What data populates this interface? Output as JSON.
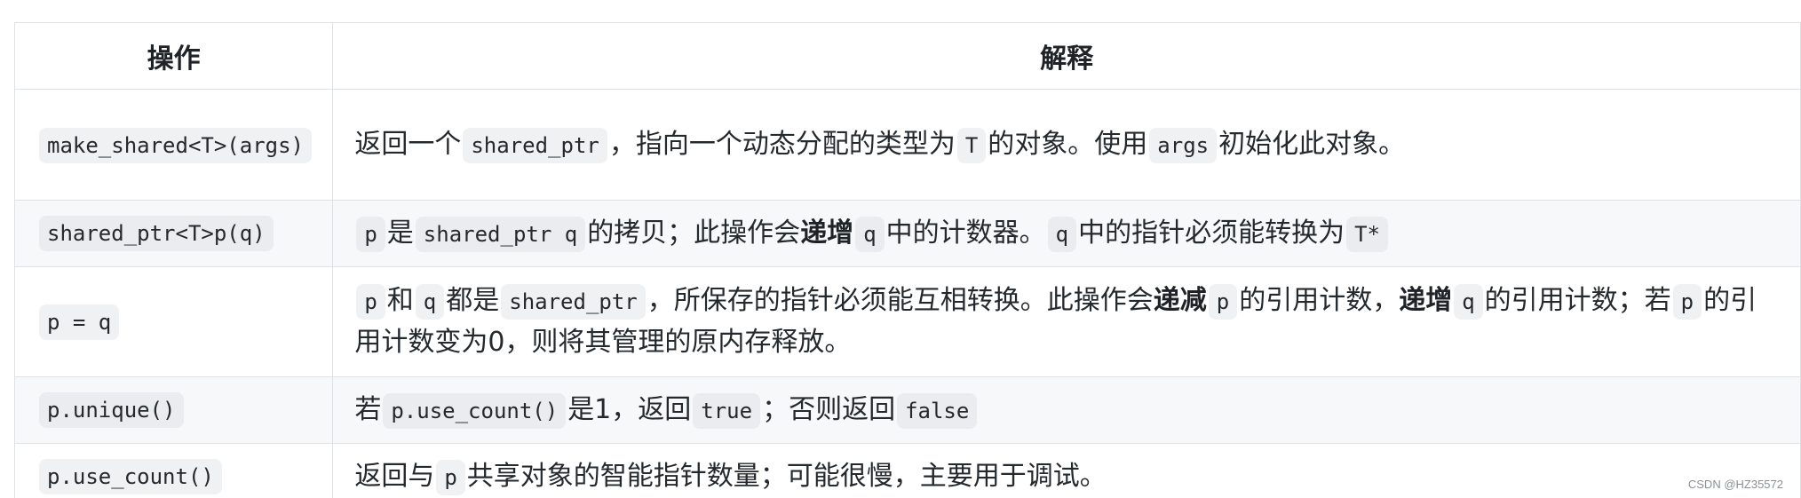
{
  "table": {
    "headers": [
      "操作",
      "解释"
    ],
    "rows": [
      {
        "op": "make_shared<T>(args)",
        "desc": [
          {
            "t": "text",
            "v": "返回一个"
          },
          {
            "t": "code",
            "v": "shared_ptr"
          },
          {
            "t": "text",
            "v": "，指向一个动态分配的类型为"
          },
          {
            "t": "code",
            "v": "T"
          },
          {
            "t": "text",
            "v": "的对象。使用"
          },
          {
            "t": "code",
            "v": "args"
          },
          {
            "t": "text",
            "v": "初始化此对象。"
          }
        ]
      },
      {
        "op": "shared_ptr<T>p(q)",
        "desc": [
          {
            "t": "code",
            "v": "p"
          },
          {
            "t": "text",
            "v": "是"
          },
          {
            "t": "code",
            "v": "shared_ptr q"
          },
          {
            "t": "text",
            "v": "的拷贝；此操作会"
          },
          {
            "t": "bold",
            "v": "递增"
          },
          {
            "t": "code",
            "v": "q"
          },
          {
            "t": "text",
            "v": "中的计数器。"
          },
          {
            "t": "code",
            "v": "q"
          },
          {
            "t": "text",
            "v": "中的指针必须能转换为"
          },
          {
            "t": "code",
            "v": "T*"
          }
        ]
      },
      {
        "op": "p = q",
        "desc": [
          {
            "t": "code",
            "v": "p"
          },
          {
            "t": "text",
            "v": "和"
          },
          {
            "t": "code",
            "v": "q"
          },
          {
            "t": "text",
            "v": "都是"
          },
          {
            "t": "code",
            "v": "shared_ptr"
          },
          {
            "t": "text",
            "v": "，所保存的指针必须能互相转换。此操作会"
          },
          {
            "t": "bold",
            "v": "递减"
          },
          {
            "t": "code",
            "v": "p"
          },
          {
            "t": "text",
            "v": "的引用计数，"
          },
          {
            "t": "bold",
            "v": "递增"
          },
          {
            "t": "code",
            "v": "q"
          },
          {
            "t": "text",
            "v": "的引用计数；若"
          },
          {
            "t": "code",
            "v": "p"
          },
          {
            "t": "text",
            "v": "的引用计数变为0，则将其管理的原内存释放。"
          }
        ]
      },
      {
        "op": "p.unique()",
        "desc": [
          {
            "t": "text",
            "v": "若"
          },
          {
            "t": "code",
            "v": "p.use_count()"
          },
          {
            "t": "text",
            "v": "是1，返回"
          },
          {
            "t": "code",
            "v": "true"
          },
          {
            "t": "text",
            "v": "；否则返回"
          },
          {
            "t": "code",
            "v": "false"
          }
        ]
      },
      {
        "op": "p.use_count()",
        "desc": [
          {
            "t": "text",
            "v": "返回与"
          },
          {
            "t": "code",
            "v": "p"
          },
          {
            "t": "text",
            "v": "共享对象的智能指针数量；可能很慢，主要用于调试。"
          }
        ]
      }
    ]
  },
  "watermark": "CSDN @HZ35572"
}
